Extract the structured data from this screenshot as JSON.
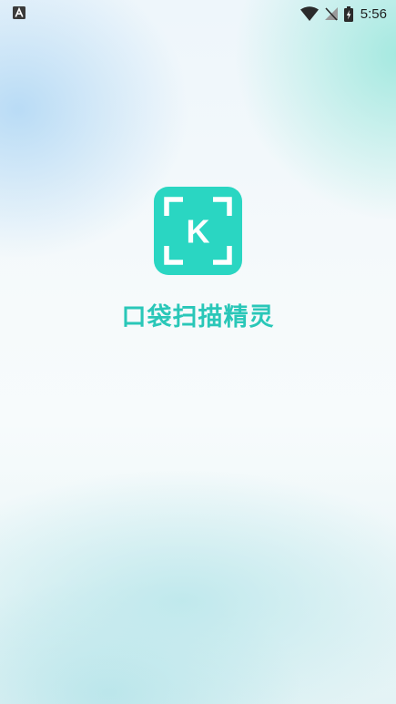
{
  "status_bar": {
    "time": "5:56",
    "notification_icon": "a-notification-icon",
    "wifi_icon": "wifi-icon",
    "signal_icon": "no-signal-icon",
    "battery_icon": "battery-charging-icon"
  },
  "splash": {
    "logo_icon": "scan-frame-k-icon",
    "logo_letter": "K",
    "app_name": "口袋扫描精灵"
  },
  "colors": {
    "brand": "#2ad6c2",
    "title_text": "#2ac7b8",
    "status_icons": "#2b2b2b"
  }
}
